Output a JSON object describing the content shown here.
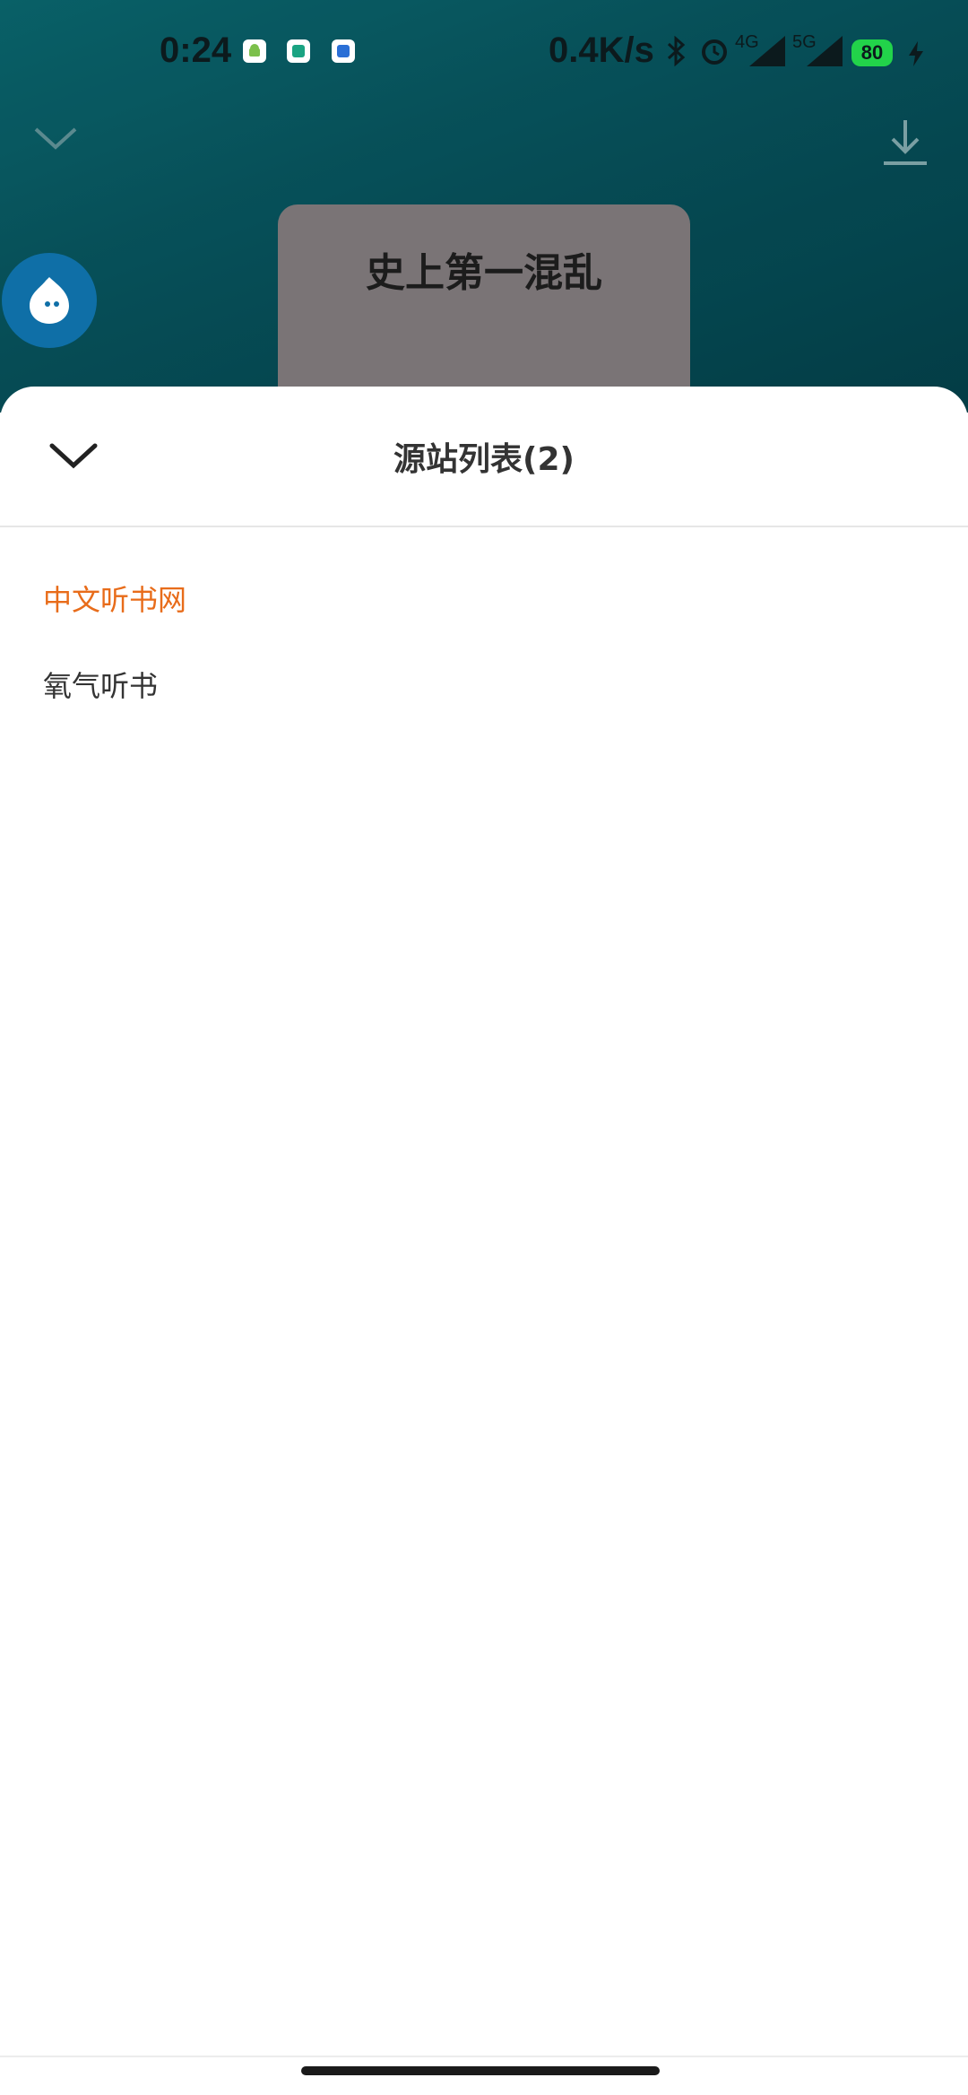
{
  "status_bar": {
    "time": "0:24",
    "net_speed": "0.4K/s",
    "net_4g": "4G",
    "net_5g": "5G",
    "battery": "80",
    "icons": [
      "android-icon",
      "app-icon",
      "security-icon",
      "bluetooth-icon",
      "alarm-icon",
      "signal-icon",
      "signal-icon",
      "charging-icon"
    ]
  },
  "player": {
    "cover_title": "史上第一混乱",
    "icons": [
      "chevron-down-icon",
      "download-icon",
      "assistant-icon"
    ]
  },
  "sheet": {
    "title": "源站列表(2)",
    "sources": [
      {
        "label": "中文听书网",
        "selected": true
      },
      {
        "label": "氧气听书",
        "selected": false
      }
    ]
  },
  "colors": {
    "accent": "#e86c1a",
    "header_bg": "#075660",
    "battery": "#22d34a",
    "fab": "#0f6fa7"
  }
}
